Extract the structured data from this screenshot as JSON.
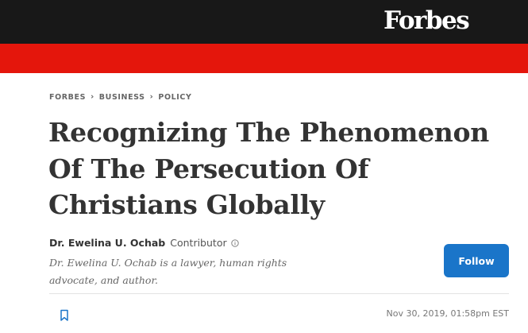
{
  "header": {
    "brand": "Forbes",
    "colors": {
      "masthead": "#181818",
      "band": "#e4160c",
      "accent": "#1a75c9"
    }
  },
  "article": {
    "breadcrumb": [
      "FORBES",
      "BUSINESS",
      "POLICY"
    ],
    "headline": "Recognizing The Phenomenon Of The Persecution Of Christians Globally",
    "author": {
      "name": "Dr. Ewelina U. Ochab",
      "role": "Contributor",
      "info_icon": "info-circle-icon",
      "bio": "Dr. Ewelina U. Ochab is a lawyer, human rights advocate, and author."
    },
    "follow_label": "Follow",
    "bookmark_icon": "bookmark-icon",
    "timestamp": "Nov 30, 2019, 01:58pm EST"
  }
}
